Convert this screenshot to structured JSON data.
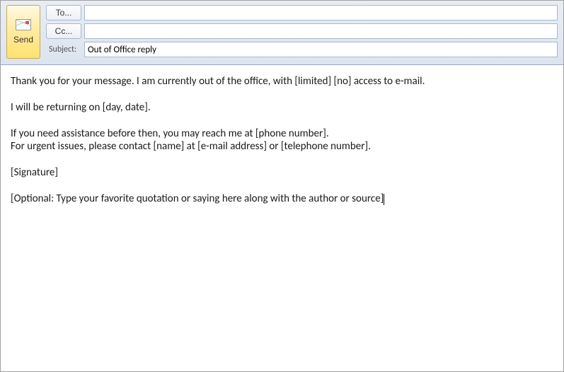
{
  "toolbar": {
    "send_label": "Send",
    "to_label": "To...",
    "cc_label": "Cc...",
    "subject_label": "Subject:"
  },
  "fields": {
    "to_value": "",
    "cc_value": "",
    "subject_value": "Out of Office reply"
  },
  "body": {
    "line1": "Thank you for your message. I am currently out of the office, with [limited] [no] access to e-mail.",
    "line2": "I will be returning on [day, date].",
    "line3a": "If you need assistance before then, you may reach me at [phone number].",
    "line3b": "For urgent issues, please contact [name] at [e-mail address] or [telephone number].",
    "line4": "[Signature]",
    "line5": "[Optional: Type your favorite quotation or saying here along with the author or source]"
  }
}
